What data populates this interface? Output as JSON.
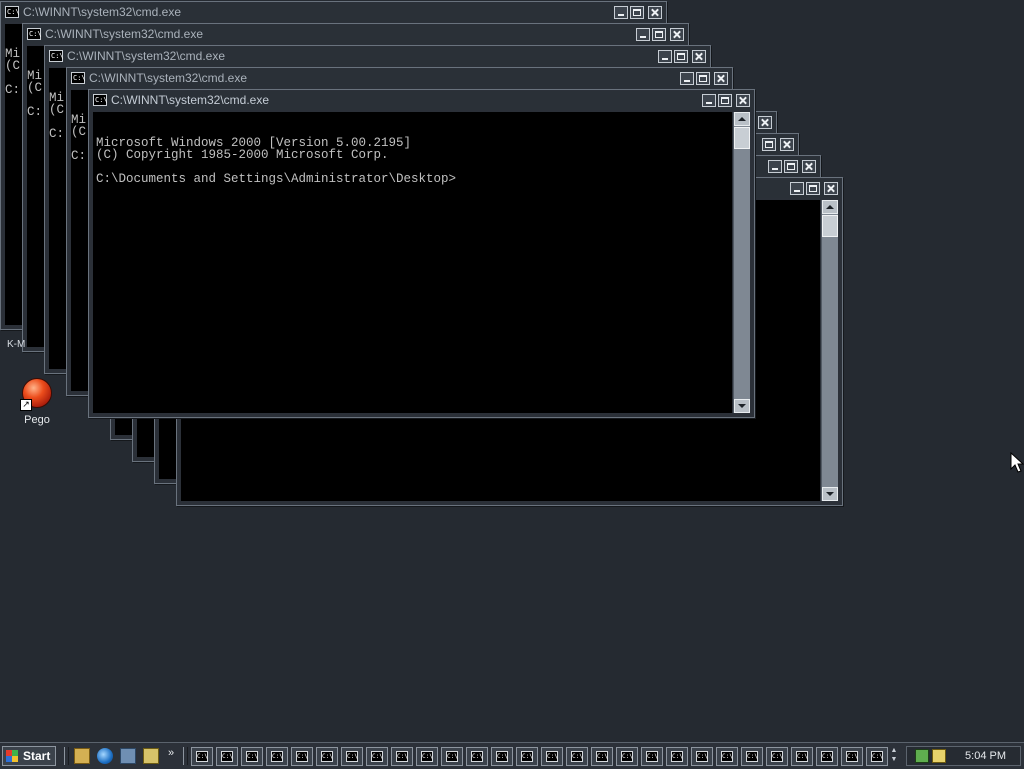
{
  "windows": [
    {
      "title": "C:\\WINNT\\system32\\cmd.exe",
      "lines": [
        "Mi",
        "(C",
        "",
        "C:"
      ]
    },
    {
      "title": "C:\\WINNT\\system32\\cmd.exe",
      "lines": [
        "Mi",
        "(C",
        "",
        "C:"
      ]
    },
    {
      "title": "C:\\WINNT\\system32\\cmd.exe",
      "lines": [
        "Mi",
        "(C",
        "",
        "C:"
      ]
    },
    {
      "title": "C:\\WINNT\\system32\\cmd.exe",
      "lines": [
        "Mi",
        "(C",
        "",
        "C:"
      ]
    },
    {
      "title": "C:\\WINNT\\system32\\cmd.exe",
      "lines": [
        "Microsoft Windows 2000 [Version 5.00.2195]",
        "(C) Copyright 1985-2000 Microsoft Corp.",
        "",
        "C:\\Documents and Settings\\Administrator\\Desktop>"
      ]
    }
  ],
  "app_icon_text": "C:\\",
  "desktop": {
    "icon_label": "Pego",
    "partial_label": "K-M"
  },
  "taskbar": {
    "start_label": "Start",
    "quicklaunch_more": "»",
    "task_icon_text": "C:\\",
    "clock": "5:04 PM"
  },
  "colors": {
    "desktop": "#252a31",
    "console_bg": "#000000",
    "console_text": "#c0c0c0"
  }
}
